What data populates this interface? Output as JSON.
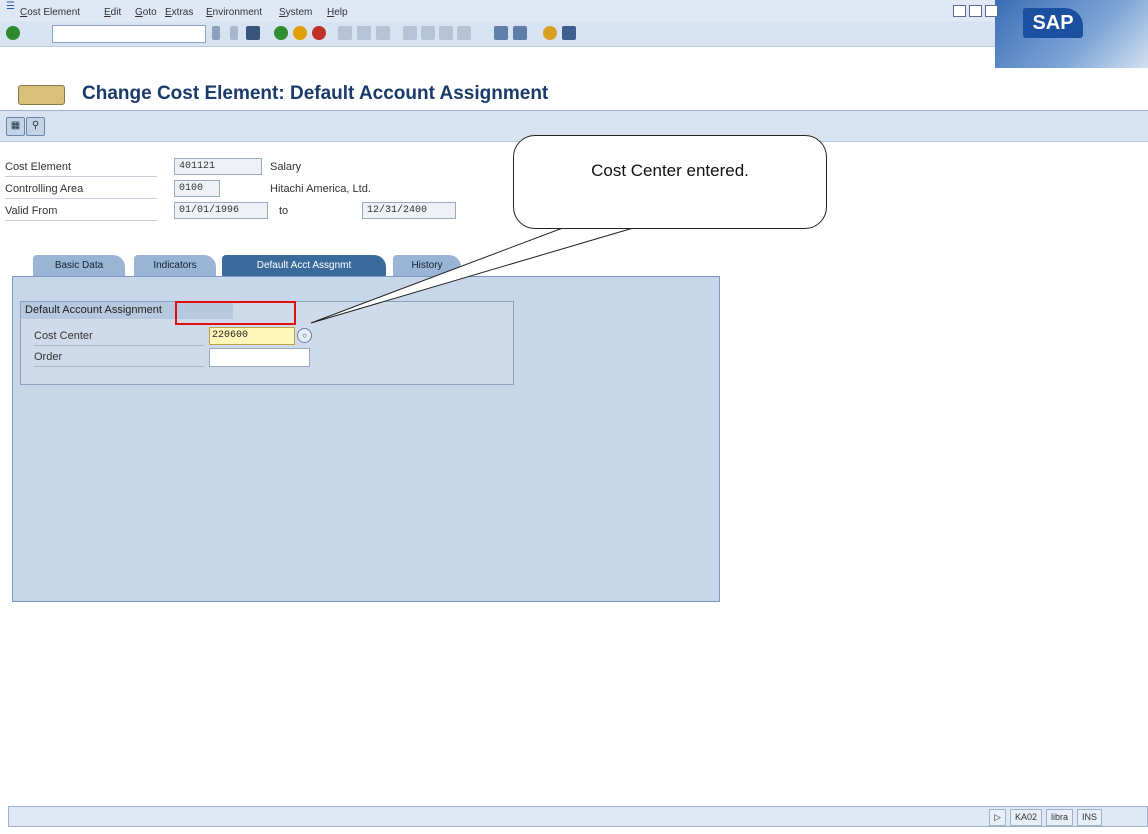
{
  "menu": [
    "Cost Element",
    "Edit",
    "Goto",
    "Extras",
    "Environment",
    "System",
    "Help"
  ],
  "brand": "SAP",
  "title": "Change Cost Element: Default Account Assignment",
  "header": {
    "cost_element_label": "Cost Element",
    "cost_element_value": "401121",
    "cost_element_desc": "Salary",
    "controlling_area_label": "Controlling Area",
    "controlling_area_value": "0100",
    "controlling_area_desc": "Hitachi America, Ltd.",
    "valid_from_label": "Valid From",
    "valid_from_value": "01/01/1996",
    "to_label": "to",
    "valid_to_value": "12/31/2400"
  },
  "tabs": [
    "Basic Data",
    "Indicators",
    "Default Acct Assgnmt",
    "History"
  ],
  "group": {
    "title": "Default Account Assignment",
    "cost_center_label": "Cost Center",
    "cost_center_value": "220600",
    "order_label": "Order",
    "order_value": ""
  },
  "callout": "Cost Center entered.",
  "status": {
    "transaction": "KA02",
    "client": "libra",
    "mode": "INS"
  }
}
